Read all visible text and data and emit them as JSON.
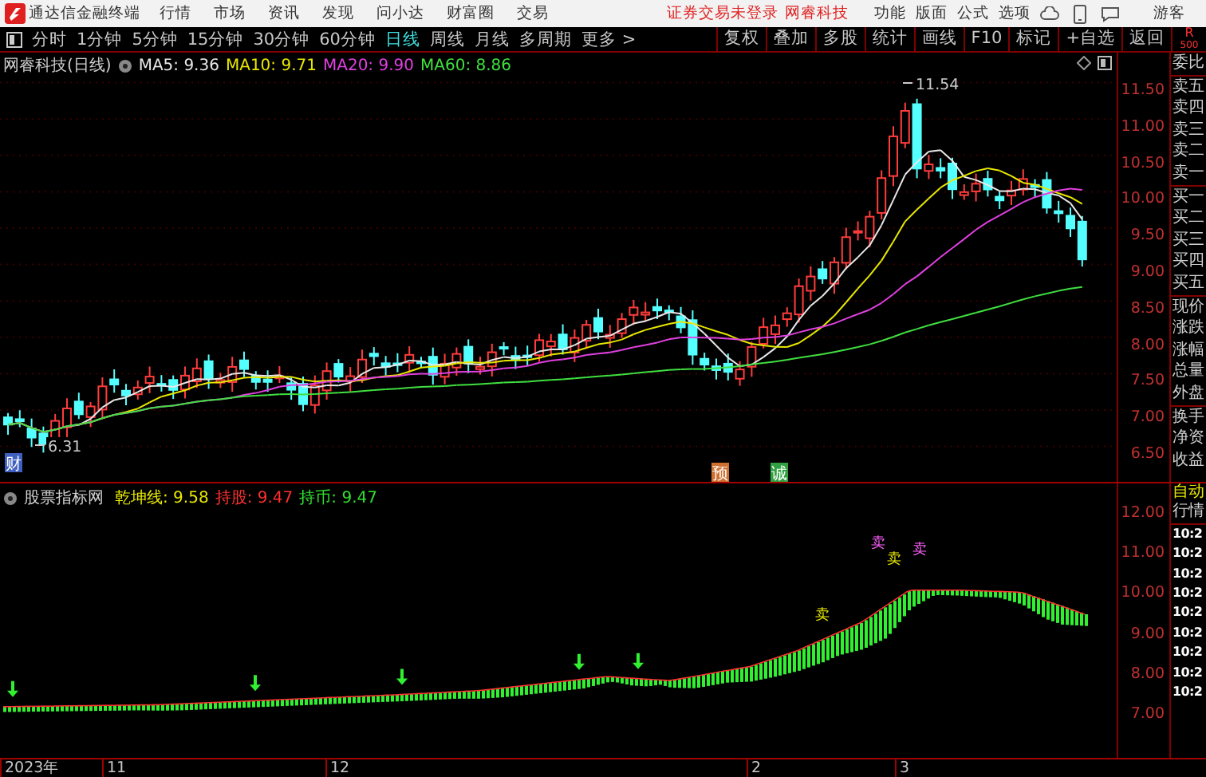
{
  "app": {
    "title": "通达信金融终端",
    "menus": [
      "行情",
      "市场",
      "资讯",
      "发现",
      "问小达",
      "财富圈",
      "交易"
    ],
    "login_status": "证券交易未登录",
    "account": "网睿科技",
    "tools": [
      "功能",
      "版面",
      "公式",
      "选项"
    ],
    "user": "游客"
  },
  "periods": [
    {
      "label": "分时",
      "selected": false
    },
    {
      "label": "1分钟",
      "selected": false
    },
    {
      "label": "5分钟",
      "selected": false
    },
    {
      "label": "15分钟",
      "selected": false
    },
    {
      "label": "30分钟",
      "selected": false
    },
    {
      "label": "60分钟",
      "selected": false
    },
    {
      "label": "日线",
      "selected": true
    },
    {
      "label": "周线",
      "selected": false
    },
    {
      "label": "月线",
      "selected": false
    },
    {
      "label": "多周期",
      "selected": false
    }
  ],
  "more": "更多 >",
  "actions": [
    "复权",
    "叠加",
    "多股",
    "统计",
    "画线",
    "F10",
    "标记",
    "+自选",
    "返回"
  ],
  "badge": {
    "line1": "R",
    "line2": "500"
  },
  "main_chart": {
    "title": "网睿科技(日线)",
    "indicators": [
      {
        "label": "MA5:",
        "value": "9.36",
        "color": "#e8e8e8"
      },
      {
        "label": "MA10:",
        "value": "9.71",
        "color": "#e8e800"
      },
      {
        "label": "MA20:",
        "value": "9.90",
        "color": "#e040e0"
      },
      {
        "label": "MA60:",
        "value": "8.86",
        "color": "#40e040"
      }
    ],
    "price_axis": [
      "11.50",
      "11.00",
      "10.50",
      "10.00",
      "9.50",
      "9.00",
      "8.50",
      "8.00",
      "7.50",
      "7.00",
      "6.50"
    ],
    "annotations": [
      {
        "kind": "price",
        "text": "11.54"
      },
      {
        "kind": "price",
        "text": "6.31"
      },
      {
        "kind": "tag",
        "text": "财",
        "color": "#4060c0"
      },
      {
        "kind": "tag",
        "text": "预",
        "color": "#d07030"
      },
      {
        "kind": "tag",
        "text": "诚",
        "color": "#30a040"
      }
    ]
  },
  "sub_chart": {
    "title": "股票指标网",
    "indicators": [
      {
        "label": "乾坤线:",
        "value": "9.58",
        "color": "#e8e800"
      },
      {
        "label": "持股:",
        "value": "9.47",
        "color": "#ff3030"
      },
      {
        "label": "持币:",
        "value": "9.47",
        "color": "#30e030"
      }
    ],
    "axis": [
      "12.00",
      "11.00",
      "10.00",
      "9.00",
      "8.00",
      "7.00"
    ],
    "signals": [
      "卖",
      "卖",
      "卖",
      "卖"
    ]
  },
  "side_panel": {
    "items": [
      "委比",
      "卖五",
      "卖四",
      "卖三",
      "卖二",
      "卖一",
      "买一",
      "买二",
      "买三",
      "买四",
      "买五",
      "现价",
      "涨跌",
      "涨幅",
      "总量",
      "外盘",
      "换手",
      "净资",
      "收益"
    ]
  },
  "side_panel_lower": {
    "items": [
      "自动",
      "行情"
    ],
    "times": [
      "10:2",
      "10:2",
      "10:2",
      "10:2",
      "10:2",
      "10:2",
      "10:2",
      "10:2",
      "10:2"
    ]
  },
  "date_axis": [
    "2023年",
    "11",
    "12",
    "2",
    "3"
  ]
}
